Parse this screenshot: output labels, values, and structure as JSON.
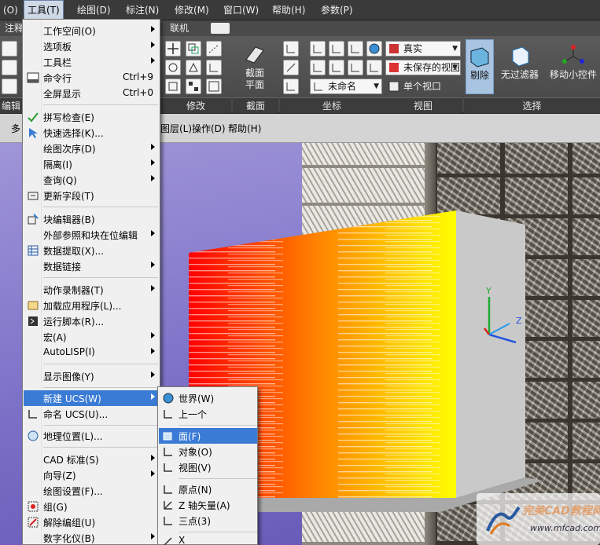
{
  "menubar": {
    "items": [
      {
        "label": "(O)"
      },
      {
        "label": "工具(T)"
      },
      {
        "label": "绘图(D)"
      },
      {
        "label": "标注(N)"
      },
      {
        "label": "修改(M)"
      },
      {
        "label": "窗口(W)"
      },
      {
        "label": "帮助(H)"
      },
      {
        "label": "参数(P)"
      }
    ]
  },
  "ribbon": {
    "tabs": [
      {
        "label": "注释"
      },
      {
        "label": "联机"
      }
    ],
    "panels": [
      {
        "title": "编辑"
      },
      {
        "title": "修改"
      },
      {
        "title": "截面"
      },
      {
        "title": "坐标"
      },
      {
        "title": "视图"
      },
      {
        "title": "选择"
      }
    ],
    "section_button": {
      "label_line1": "截面",
      "label_line2": "平面"
    },
    "visual_style_combo": "真实",
    "saved_view_combo": "未保存的视图",
    "ucs_name_combo": "未命名",
    "viewport_combo": "单个视口",
    "cull_button": "剔除",
    "no_filter_button": "无过滤器",
    "move_gizmo_button": "移动小控件"
  },
  "toolbar2": {
    "items": [
      {
        "label": "多"
      },
      {
        "label": "图层(L)"
      },
      {
        "label": "操作(D)"
      },
      {
        "label": "帮助(H)"
      }
    ]
  },
  "tools_menu": {
    "items": [
      {
        "label": "工作空间(O)"
      },
      {
        "label": "选项板"
      },
      {
        "label": "工具栏"
      },
      {
        "label": "命令行",
        "shortcut": "Ctrl+9"
      },
      {
        "label": "全屏显示",
        "shortcut": "Ctrl+0"
      },
      {
        "label": "拼写检查(E)"
      },
      {
        "label": "快速选择(K)..."
      },
      {
        "label": "绘图次序(D)"
      },
      {
        "label": "隔离(I)"
      },
      {
        "label": "查询(Q)"
      },
      {
        "label": "更新字段(T)"
      },
      {
        "label": "块编辑器(B)"
      },
      {
        "label": "外部参照和块在位编辑"
      },
      {
        "label": "数据提取(X)..."
      },
      {
        "label": "数据链接"
      },
      {
        "label": "动作录制器(T)"
      },
      {
        "label": "加载应用程序(L)..."
      },
      {
        "label": "运行脚本(R)..."
      },
      {
        "label": "宏(A)"
      },
      {
        "label": "AutoLISP(I)"
      },
      {
        "label": "显示图像(Y)"
      },
      {
        "label": "新建 UCS(W)"
      },
      {
        "label": "命名 UCS(U)..."
      },
      {
        "label": "地理位置(L)..."
      },
      {
        "label": "CAD 标准(S)"
      },
      {
        "label": "向导(Z)"
      },
      {
        "label": "绘图设置(F)..."
      },
      {
        "label": "组(G)"
      },
      {
        "label": "解除编组(U)"
      },
      {
        "label": "数字化仪(B)"
      }
    ]
  },
  "ucs_submenu": {
    "items": [
      {
        "label": "世界(W)"
      },
      {
        "label": "上一个"
      },
      {
        "label": "面(F)"
      },
      {
        "label": "对象(O)"
      },
      {
        "label": "视图(V)"
      },
      {
        "label": "原点(N)"
      },
      {
        "label": "Z 轴矢量(A)"
      },
      {
        "label": "三点(3)"
      },
      {
        "label": "X"
      }
    ]
  },
  "axis_labels": {
    "y": "Y",
    "z": "Z"
  },
  "watermark": {
    "title": "完美CAD教程网",
    "url": "www.mfcad.com"
  },
  "colors": {
    "highlight": "#3a7bd5",
    "gradient_start": "#ff0000",
    "gradient_end": "#ffff00"
  }
}
